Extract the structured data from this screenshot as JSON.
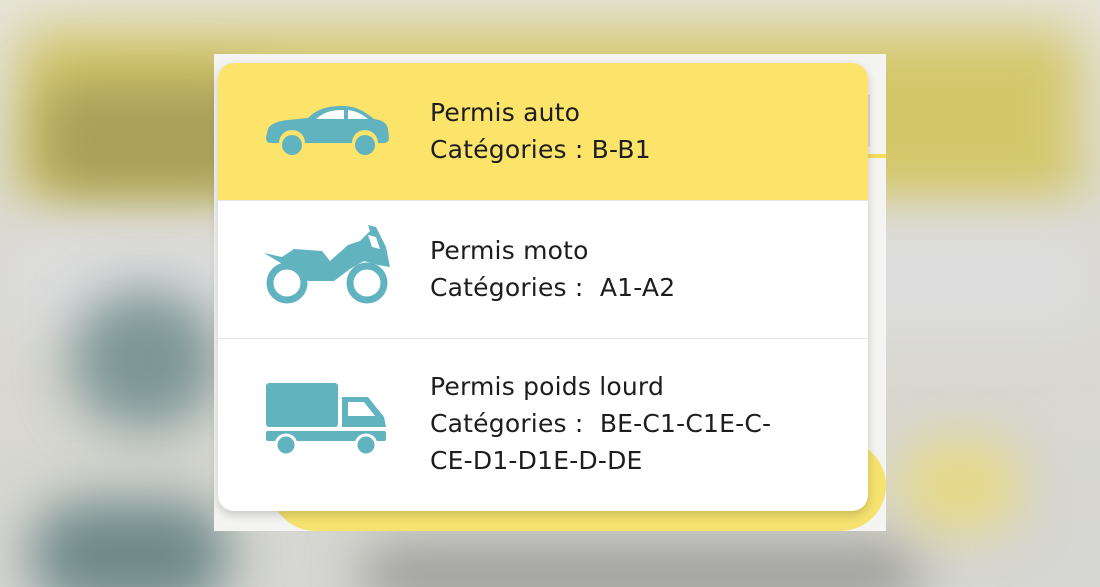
{
  "colors": {
    "selected_background": "#fce46a",
    "icon": "#62b3c0",
    "text": "#1d1d1d"
  },
  "license_options": [
    {
      "title": "Permis auto",
      "categories_label": "Catégories : B-B1",
      "icon": "car-icon",
      "selected": true
    },
    {
      "title": "Permis moto",
      "categories_label": "Catégories :  A1-A2",
      "icon": "motorcycle-icon",
      "selected": false
    },
    {
      "title": "Permis poids lourd",
      "categories_label": "Catégories :  BE-C1-C1E-C-",
      "categories_label_continued": "CE-D1-D1E-D-DE",
      "icon": "truck-icon",
      "selected": false
    }
  ]
}
